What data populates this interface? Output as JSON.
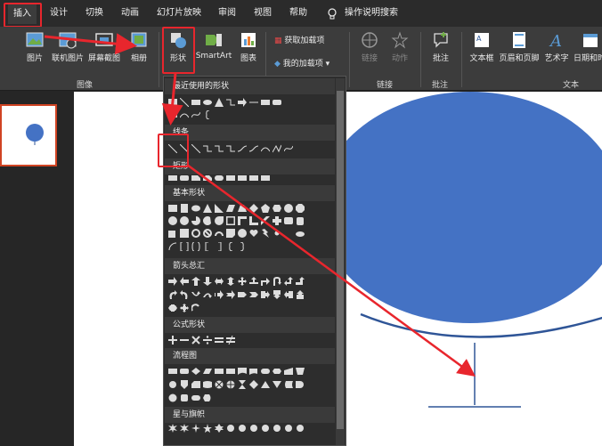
{
  "tabs": [
    {
      "label": "插入",
      "active": true
    },
    {
      "label": "设计"
    },
    {
      "label": "切换"
    },
    {
      "label": "动画"
    },
    {
      "label": "幻灯片放映"
    },
    {
      "label": "审阅"
    },
    {
      "label": "视图"
    },
    {
      "label": "帮助"
    }
  ],
  "tell_me": "操作说明搜索",
  "ribbon": {
    "picture": "图片",
    "online_picture": "联机图片",
    "screenshot": "屏幕截图",
    "album": "相册",
    "shapes": "形状",
    "smartart": "SmartArt",
    "chart": "图表",
    "get_addins": "获取加载项",
    "my_addins": "我的加载项",
    "link": "链接",
    "action": "动作",
    "comment": "批注",
    "textbox": "文本框",
    "header_footer": "页眉和页脚",
    "wordart": "艺术字",
    "datetime": "日期和时",
    "group_images": "图像",
    "group_links": "链接",
    "group_comments": "批注",
    "group_text": "文本"
  },
  "gallery": {
    "recent": "最近使用的形状",
    "lines": "线条",
    "rect": "矩形",
    "basic": "基本形状",
    "arrows": "箭头总汇",
    "equation": "公式形状",
    "flowchart": "流程图",
    "stars": "星与旗帜"
  },
  "colors": {
    "highlight": "#e8262d",
    "shape_fill": "#4472c4",
    "line": "#2f5597"
  }
}
